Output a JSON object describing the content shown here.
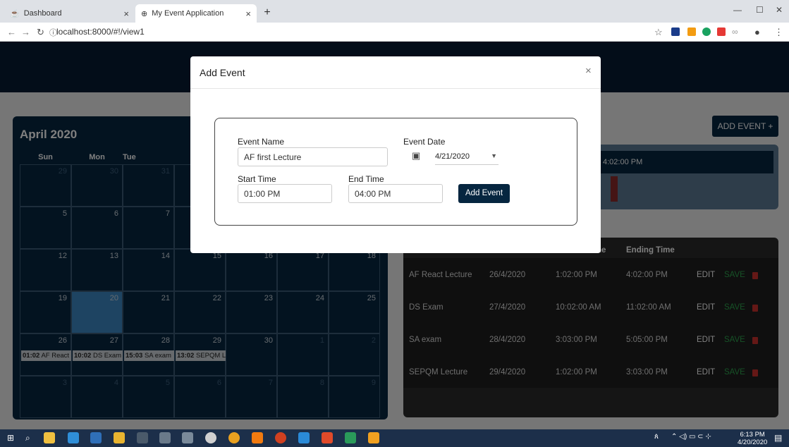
{
  "browser": {
    "tabs": [
      {
        "label": "Dashboard"
      },
      {
        "label": "My Event Application"
      }
    ],
    "close_glyph": "×",
    "newtab_glyph": "+",
    "url": "localhost:8000/#!/view1",
    "nav_icons": [
      "back-icon",
      "forward-icon",
      "reload-icon",
      "info-icon"
    ],
    "window_controls": [
      "minimize-icon",
      "maximize-icon",
      "close-icon"
    ]
  },
  "calendar": {
    "title": "April 2020",
    "weekdays": [
      "Sun",
      "Mon",
      "Tue"
    ],
    "weeks": [
      [
        "29",
        "30",
        "31",
        "",
        "",
        "",
        ""
      ],
      [
        "5",
        "6",
        "7",
        "",
        "",
        "",
        ""
      ],
      [
        "12",
        "13",
        "14",
        "15",
        "16",
        "17",
        "18"
      ],
      [
        "19",
        "20",
        "21",
        "22",
        "23",
        "24",
        "25"
      ],
      [
        "26",
        "27",
        "28",
        "29",
        "30",
        "1",
        "2"
      ],
      [
        "3",
        "4",
        "5",
        "6",
        "7",
        "8",
        "9"
      ]
    ],
    "selected_day": "20",
    "chips": [
      {
        "time": "01:02",
        "text": "AF React"
      },
      {
        "time": "10:02",
        "text": "DS Exam"
      },
      {
        "time": "15:03",
        "text": "SA exam"
      },
      {
        "time": "13:02",
        "text": "SEPQM L"
      }
    ]
  },
  "add_event_button": "ADD EVENT +",
  "highlight_time": "4:02:00 PM",
  "table": {
    "headers": [
      "ne",
      "Ending Time"
    ],
    "rows": [
      {
        "name": "AF React Lecture",
        "date": "26/4/2020",
        "start": "1:02:00 PM",
        "end": "4:02:00 PM"
      },
      {
        "name": "DS Exam",
        "date": "27/4/2020",
        "start": "10:02:00 AM",
        "end": "11:02:00 AM"
      },
      {
        "name": "SA exam",
        "date": "28/4/2020",
        "start": "3:03:00 PM",
        "end": "5:05:00 PM"
      },
      {
        "name": "SEPQM Lecture",
        "date": "29/4/2020",
        "start": "1:02:00 PM",
        "end": "3:03:00 PM"
      }
    ],
    "edit_label": "EDIT",
    "save_label": "SAVE"
  },
  "modal": {
    "title": "Add Event",
    "close": "×",
    "event_name_label": "Event Name",
    "event_name_value": "AF first Lecture",
    "event_date_label": "Event Date",
    "event_date_value": "4/21/2020",
    "start_time_label": "Start Time",
    "start_time_value": "01:00 PM",
    "end_time_label": "End Time",
    "end_time_value": "04:00 PM",
    "submit_label": "Add Event"
  },
  "taskbar": {
    "time": "6:13 PM",
    "date": "4/20/2020"
  },
  "colors": {
    "navy": "#062640",
    "selected": "#3c89c4",
    "save_green": "#2da44e",
    "delete_red": "#c9302c"
  }
}
